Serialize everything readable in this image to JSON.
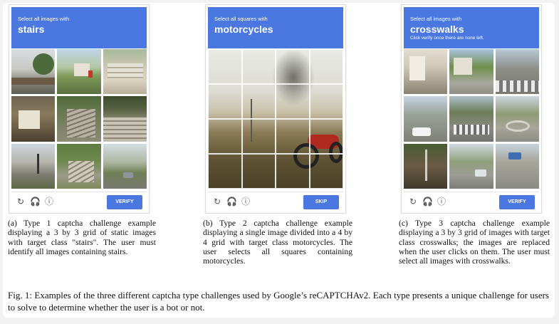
{
  "widgets": [
    {
      "instruction": "Select all images with",
      "target": "stairs",
      "note": "",
      "button_label": "VERIFY",
      "icons": [
        "reload-icon",
        "headphones-icon",
        "info-icon"
      ]
    },
    {
      "instruction": "Select all squares with",
      "target": "motorcycles",
      "note": "",
      "button_label": "SKIP",
      "icons": [
        "reload-icon",
        "headphones-icon",
        "info-icon"
      ]
    },
    {
      "instruction": "Select all images with",
      "target": "crosswalks",
      "note": "Click verify once there are none left.",
      "button_label": "VERIFY",
      "icons": [
        "reload-icon",
        "headphones-icon",
        "info-icon"
      ]
    }
  ],
  "captions": [
    "(a) Type 1 captcha challenge example displaying a 3 by 3 grid of static images with target class \"stairs\". The user must identify all images containing stairs.",
    "(b) Type 2 captcha challenge example displaying a single image divided into a 4 by 4 grid with target class motorcycles. The user selects all squares containing motorcycles.",
    "(c) Type 3 captcha challenge example displaying a 3 by 3 grid of images with target class crosswalks; the images are replaced when the user clicks on them. The user must select all images with crosswalks."
  ],
  "figure_caption": "Fig. 1: Examples of the three different captcha type challenges used by Google’s reCAPTCHAv2. Each type presents a unique challenge for users to solve to determine whether the user is a bot or not.",
  "colors": {
    "header_blue": "#4a78e0",
    "button_blue": "#4a78e0"
  }
}
